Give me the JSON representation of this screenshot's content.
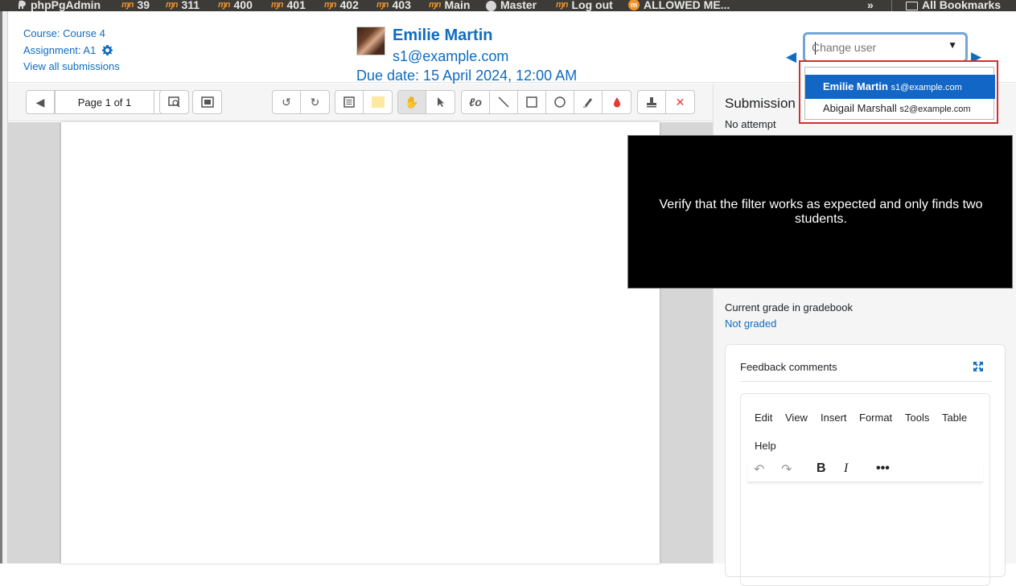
{
  "bookmarks": {
    "items": [
      {
        "label": "phpPgAdmin",
        "icon": "elephant-icon"
      },
      {
        "label": "39",
        "icon": "moodle-icon"
      },
      {
        "label": "311",
        "icon": "moodle-icon"
      },
      {
        "label": "400",
        "icon": "moodle-icon"
      },
      {
        "label": "401",
        "icon": "moodle-icon"
      },
      {
        "label": "402",
        "icon": "moodle-icon"
      },
      {
        "label": "403",
        "icon": "moodle-icon"
      },
      {
        "label": "Main",
        "icon": "moodle-icon"
      },
      {
        "label": "Master",
        "icon": "globe-icon"
      },
      {
        "label": "Log out",
        "icon": "moodle-icon"
      },
      {
        "label": "ALLOWED ME...",
        "icon": "orange-moodle-icon"
      }
    ],
    "overflow": "»",
    "all_bookmarks": "All Bookmarks"
  },
  "header": {
    "course_link": "Course: Course 4",
    "assignment_link": "Assignment: A1",
    "view_all": "View all submissions",
    "user_name": "Emilie Martin",
    "user_email": "s1@example.com",
    "due_date": "Due date: 15 April 2024, 12:00 AM",
    "prev_arrow": "◀",
    "next_arrow": "▶",
    "change_user_placeholder": "Change user",
    "select_arrow": "▼"
  },
  "dropdown": {
    "options": [
      {
        "name": "Emilie Martin",
        "email": "s1@example.com",
        "selected": true
      },
      {
        "name": "Abigail Marshall",
        "email": "s2@example.com",
        "selected": false
      }
    ]
  },
  "toolbar": {
    "page_label": "Page 1 of 1"
  },
  "submission": {
    "title": "Submission",
    "status": "No attempt",
    "grade_label": "Current grade in gradebook",
    "grade_value": "Not graded"
  },
  "feedback": {
    "title": "Feedback comments",
    "menus": [
      "Edit",
      "View",
      "Insert",
      "Format",
      "Tools",
      "Table",
      "Help"
    ]
  },
  "overlay": {
    "text": "Verify that the filter works as expected and only finds two students."
  },
  "colors": {
    "accent": "#0f6cbf",
    "selected_option": "#1266c6",
    "dropdown_border": "#d32f2f",
    "bookmarks_bg": "#3c3b37"
  }
}
